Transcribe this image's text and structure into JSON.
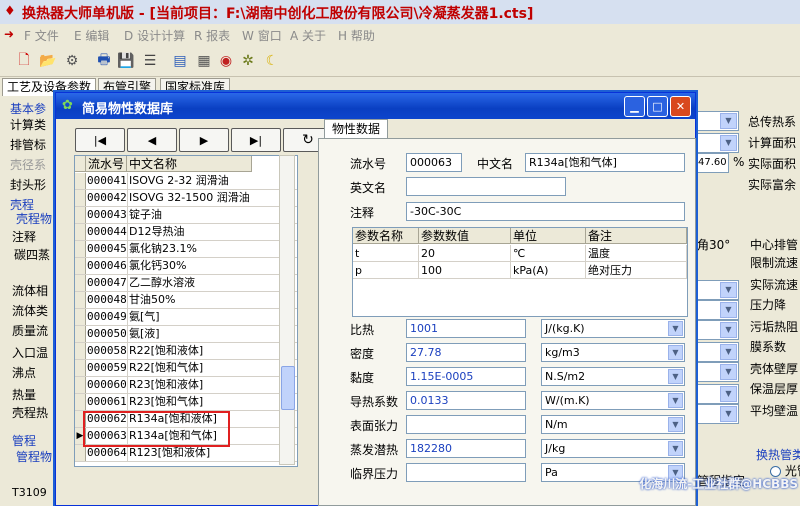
{
  "app": {
    "title": "换热器大师单机版 - [当前项目：F:\\湖南中创化工股份有限公司\\冷凝蒸发器1.cts]",
    "colors": {
      "title_text": "#c00000",
      "xp_blue": "#0a3fc2",
      "highlight_red": "#e02020"
    }
  },
  "menu": {
    "items": [
      {
        "key": "F",
        "label": "文件"
      },
      {
        "key": "E",
        "label": "编辑"
      },
      {
        "key": "D",
        "label": "设计计算"
      },
      {
        "key": "R",
        "label": "报表"
      },
      {
        "key": "W",
        "label": "窗口"
      },
      {
        "key": "A",
        "label": "关于"
      },
      {
        "key": "H",
        "label": "帮助"
      }
    ]
  },
  "toolbar": {
    "icons": [
      "new-file-icon",
      "open-icon",
      "settings-icon",
      "print-preview-icon",
      "save-icon",
      "list-icon",
      "report-icon",
      "calc-icon",
      "target-icon",
      "moon-icon"
    ]
  },
  "main_tabs": [
    "工艺及设备参数",
    "布管引擎",
    "国家标准库"
  ],
  "background": {
    "left_labels": [
      "基本参",
      "计算类",
      "排管标",
      "壳径系",
      "封头形",
      "壳程",
      "壳程物",
      "注释",
      "碳四蒸",
      "流体相",
      "流体类",
      "质量流",
      "入口温",
      "沸点",
      "热量",
      "壳程热",
      "管程",
      "管程物",
      "T3109"
    ],
    "right_labels": [
      "总传热系",
      "计算面积",
      "实际面积",
      "实际富余",
      "角30°",
      "中心排管",
      "限制流速",
      "实际流速",
      "压力降",
      "污垢热阻",
      "膜系数",
      "壳体壁厚",
      "保温层厚",
      "平均壁温",
      "换热管类",
      "光管",
      "管程指定"
    ],
    "percent_value": "47.60",
    "percent_unit": "%"
  },
  "dialog": {
    "title": "简易物性数据库",
    "nav_buttons": {
      "first": "|◀",
      "prev": "◀",
      "next": "▶",
      "last": "▶|",
      "refresh": "↻"
    },
    "grid": {
      "columns": [
        "流水号",
        "中文名称"
      ],
      "rows": [
        {
          "id": "000041",
          "name": "ISOVG 2-32 润滑油",
          "selected": false
        },
        {
          "id": "000042",
          "name": "ISOVG 32-1500 润滑油",
          "selected": false
        },
        {
          "id": "000043",
          "name": "锭子油",
          "selected": false
        },
        {
          "id": "000044",
          "name": "D12导热油",
          "selected": false
        },
        {
          "id": "000045",
          "name": "氯化钠23.1%",
          "selected": false
        },
        {
          "id": "000046",
          "name": "氯化钙30%",
          "selected": false
        },
        {
          "id": "000047",
          "name": "乙二醇水溶液",
          "selected": false
        },
        {
          "id": "000048",
          "name": "甘油50%",
          "selected": false
        },
        {
          "id": "000049",
          "name": "氨[气]",
          "selected": false
        },
        {
          "id": "000050",
          "name": "氨[液]",
          "selected": false
        },
        {
          "id": "000058",
          "name": "R22[饱和液体]",
          "selected": false
        },
        {
          "id": "000059",
          "name": "R22[饱和气体]",
          "selected": false
        },
        {
          "id": "000060",
          "name": "R23[饱和液体]",
          "selected": false
        },
        {
          "id": "000061",
          "name": "R23[饱和气体]",
          "selected": false
        },
        {
          "id": "000062",
          "name": "R134a[饱和液体]",
          "selected": false
        },
        {
          "id": "000063",
          "name": "R134a[饱和气体]",
          "selected": true
        },
        {
          "id": "000064",
          "name": "R123[饱和液体]",
          "selected": false
        }
      ]
    },
    "panel": {
      "tab_label": "物性数据",
      "serial_label": "流水号",
      "serial_value": "000063",
      "cn_name_label": "中文名",
      "cn_name_value": "R134a[饱和气体]",
      "en_name_label": "英文名",
      "en_name_value": "",
      "note_label": "注释",
      "note_value": "-30C-30C",
      "param_table": {
        "headers": [
          "参数名称",
          "参数数值",
          "单位",
          "备注"
        ],
        "rows": [
          [
            "t",
            "20",
            "℃",
            "温度"
          ],
          [
            "p",
            "100",
            "kPa(A)",
            "绝对压力"
          ]
        ]
      },
      "properties": [
        {
          "label": "比热",
          "value": "1001",
          "unit": "J/(kg.K)"
        },
        {
          "label": "密度",
          "value": "27.78",
          "unit": "kg/m3"
        },
        {
          "label": "黏度",
          "value": "1.15E-0005",
          "unit": "N.S/m2"
        },
        {
          "label": "导热系数",
          "value": "0.0133",
          "unit": "W/(m.K)"
        },
        {
          "label": "表面张力",
          "value": "",
          "unit": "N/m"
        },
        {
          "label": "蒸发潜热",
          "value": "182280",
          "unit": "J/kg"
        },
        {
          "label": "临界压力",
          "value": "",
          "unit": "Pa"
        }
      ]
    }
  },
  "watermark": "化海川流-工业社群@HCBBS"
}
